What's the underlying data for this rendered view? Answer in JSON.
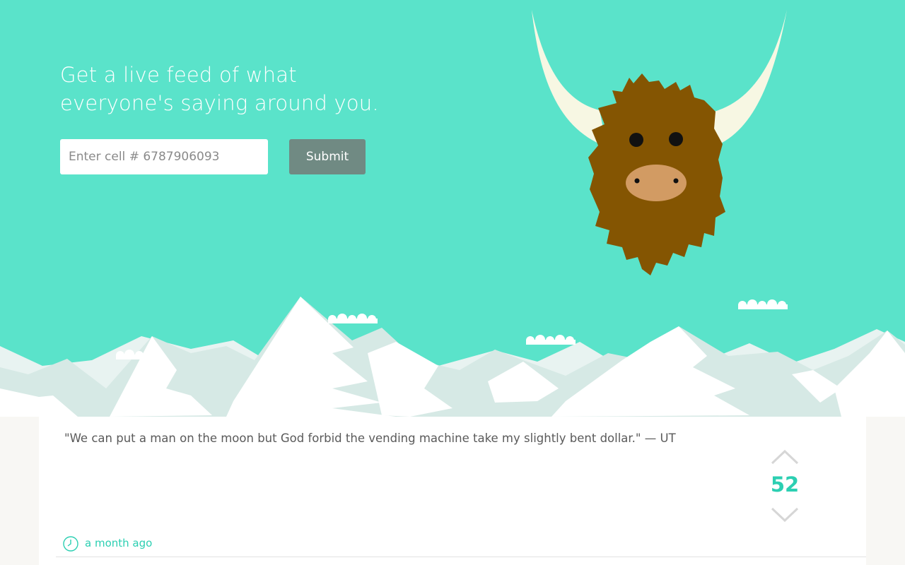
{
  "hero": {
    "headline_line1": "Get a live feed of what",
    "headline_line2": "everyone's saying around you.",
    "phone_placeholder": "Enter cell # 6787906093",
    "submit_label": "Submit",
    "mascot_icon": "yak-mascot-icon",
    "background_color": "#5ae3ca"
  },
  "post": {
    "text": "\"We can put a man on the moon but God forbid the vending machine take my slightly bent dollar.\" — UT",
    "vote_count": "52",
    "timestamp": "a month ago",
    "accent_color": "#2ccfb2"
  }
}
